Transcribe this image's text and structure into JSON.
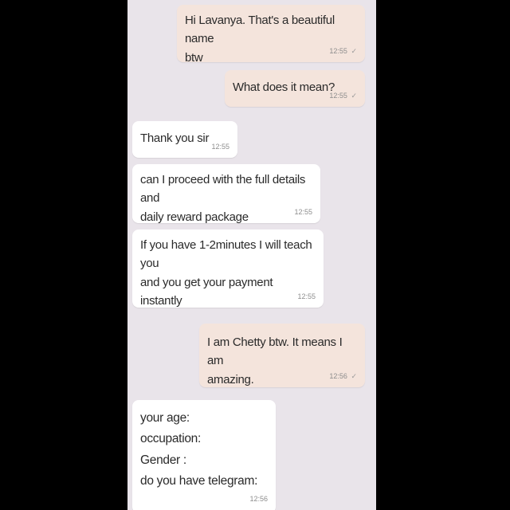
{
  "chat": {
    "messages": [
      {
        "direction": "outgoing",
        "lines": [
          "Hi Lavanya. That's a beautiful name",
          "btw"
        ],
        "time": "12:55",
        "status": "✓"
      },
      {
        "direction": "outgoing",
        "lines": [
          "What does it mean?"
        ],
        "time": "12:55",
        "status": "✓"
      },
      {
        "direction": "incoming",
        "lines": [
          "Thank you sir"
        ],
        "time": "12:55"
      },
      {
        "direction": "incoming",
        "lines": [
          "can I proceed with the full details and",
          "daily reward package"
        ],
        "time": "12:55"
      },
      {
        "direction": "incoming",
        "lines": [
          "If you have 1-2minutes I will teach you",
          "and you get your payment instantly"
        ],
        "time": "12:55"
      },
      {
        "direction": "outgoing",
        "lines": [
          "I am Chetty btw. It means I am",
          "amazing."
        ],
        "time": "12:56",
        "status": "✓"
      },
      {
        "direction": "incoming",
        "lines": [
          "your age:",
          "occupation:",
          "Gender :",
          "do you have telegram:"
        ],
        "time": "12:56"
      }
    ]
  },
  "colors": {
    "background": "#e9e4ea",
    "outgoing_bubble": "#f4e4dc",
    "incoming_bubble": "#ffffff",
    "letterbox": "#000000"
  }
}
